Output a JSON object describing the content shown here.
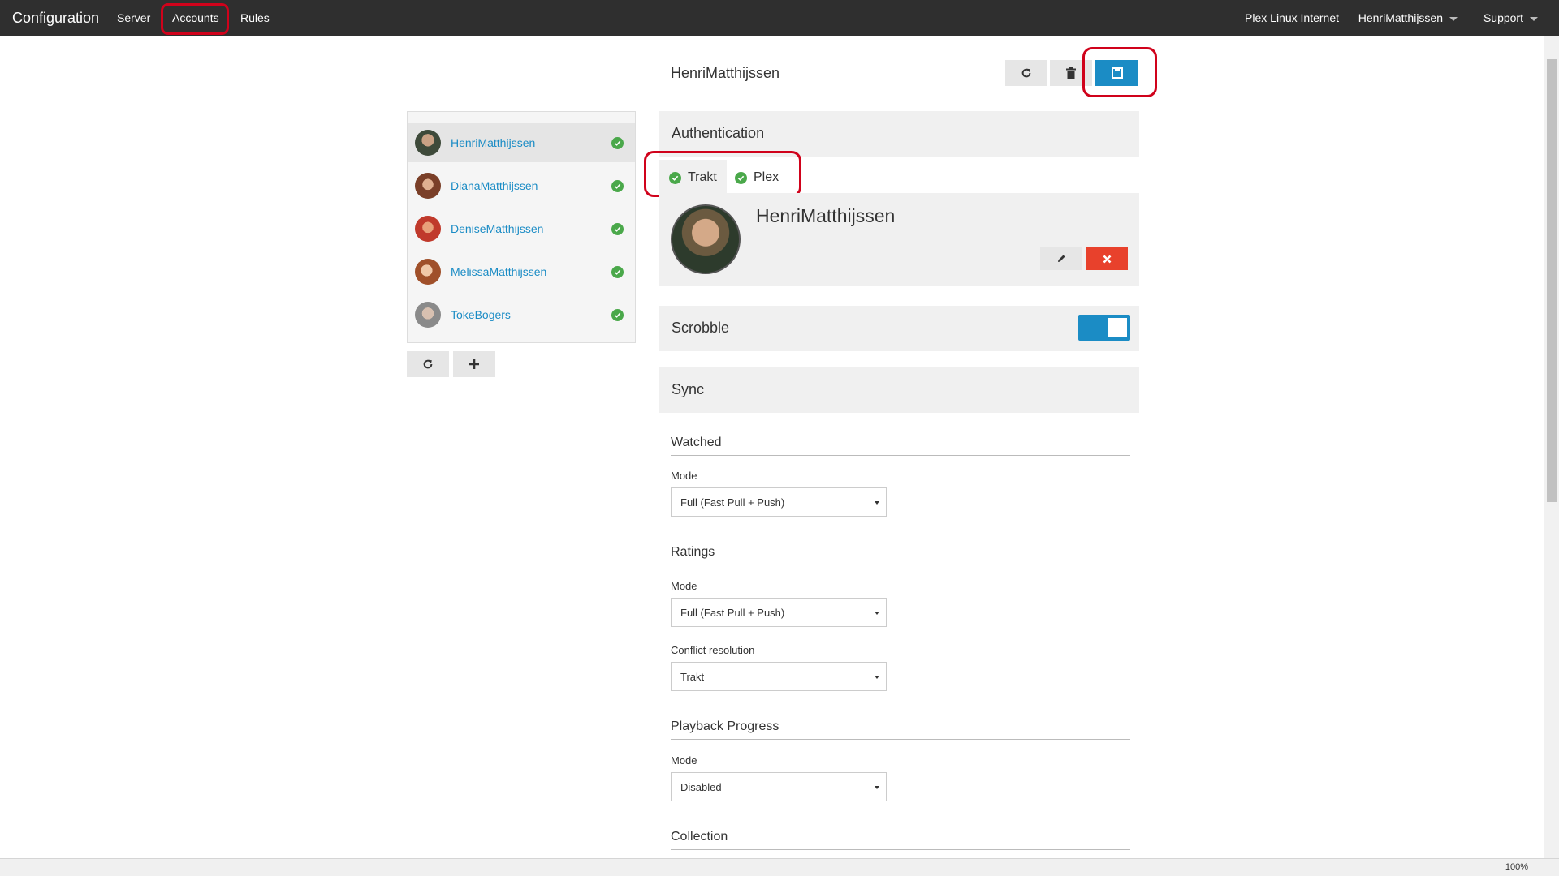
{
  "nav": {
    "brand": "Configuration",
    "links": {
      "server": "Server",
      "accounts": "Accounts",
      "rules": "Rules"
    },
    "right": {
      "server_name": "Plex Linux Internet",
      "user": "HenriMatthijssen",
      "support": "Support"
    }
  },
  "accounts": [
    {
      "name": "HenriMatthijssen",
      "status": "authenticated",
      "selected": true
    },
    {
      "name": "DianaMatthijssen",
      "status": "authenticated"
    },
    {
      "name": "DeniseMatthijssen",
      "status": "authenticated"
    },
    {
      "name": "MelissaMatthijssen",
      "status": "authenticated"
    },
    {
      "name": "TokeBogers",
      "status": "authenticated"
    }
  ],
  "account_list_actions": {
    "refresh_icon": "refresh-icon",
    "add_icon": "plus-icon"
  },
  "main": {
    "title": "HenriMatthijssen",
    "toolbar": {
      "refresh_icon": "refresh-icon",
      "delete_icon": "trash-icon",
      "save_icon": "save-icon"
    },
    "authentication": {
      "heading": "Authentication",
      "tabs": [
        {
          "label": "Trakt",
          "status": "authenticated",
          "active": true
        },
        {
          "label": "Plex",
          "status": "authenticated"
        }
      ],
      "profile_name": "HenriMatthijssen",
      "edit_icon": "pencil-icon",
      "remove_icon": "close-icon"
    },
    "scrobble": {
      "label": "Scrobble",
      "enabled": true
    },
    "sync": {
      "heading": "Sync",
      "watched": {
        "heading": "Watched",
        "mode_label": "Mode",
        "mode_value": "Full (Fast Pull + Push)"
      },
      "ratings": {
        "heading": "Ratings",
        "mode_label": "Mode",
        "mode_value": "Full (Fast Pull + Push)",
        "conflict_label": "Conflict resolution",
        "conflict_value": "Trakt"
      },
      "playback": {
        "heading": "Playback Progress",
        "mode_label": "Mode",
        "mode_value": "Disabled"
      },
      "collection": {
        "heading": "Collection"
      }
    }
  },
  "status_bar": {
    "zoom": "100%"
  },
  "colors": {
    "accent": "#1b8cc5",
    "danger": "#e8412c",
    "success": "#4aa84a",
    "navbar": "#2f2f2f",
    "highlight": "#d0021b"
  }
}
